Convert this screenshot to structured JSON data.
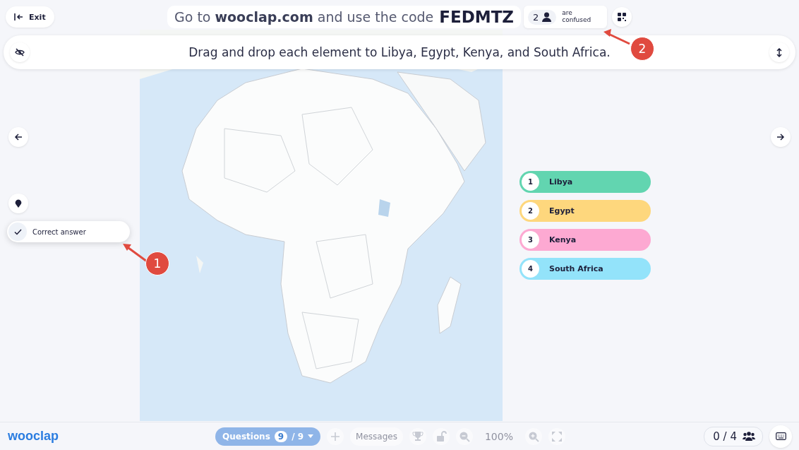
{
  "exit_button": {
    "label": "Exit"
  },
  "join_banner": {
    "text": "Go to **wooclap.com** and use the code",
    "code": "FEDMTZ"
  },
  "confused": {
    "count": "2",
    "label": "are confused"
  },
  "question": {
    "text": "Drag and drop each element to Libya, Egypt, Kenya, and South Africa.",
    "hidden_eye": true
  },
  "correct_answer": {
    "label": "Correct answer",
    "checked": true
  },
  "labels": [
    {
      "number": "1",
      "name": "Libya",
      "color": "#62d5b0"
    },
    {
      "number": "2",
      "name": "Egypt",
      "color": "#fed77d"
    },
    {
      "number": "3",
      "name": "Kenya",
      "color": "#fda9d2"
    },
    {
      "number": "4",
      "name": "South Africa",
      "color": "#93e3fa"
    }
  ],
  "annotations": [
    {
      "number": "1"
    },
    {
      "number": "2"
    }
  ],
  "footer": {
    "logo": "wooclap",
    "questions": {
      "label": "Questions",
      "current": "9",
      "total": "/ 9",
      "disabled": true
    },
    "items": [
      {
        "kind": "plus",
        "disabled": true
      },
      {
        "kind": "button",
        "label": "Messages",
        "disabled": true
      },
      {
        "kind": "trophy",
        "disabled": true
      },
      {
        "kind": "lock",
        "disabled": true
      },
      {
        "kind": "zoom_out",
        "disabled": true
      },
      {
        "kind": "zoom_level",
        "label": "100%",
        "disabled": true
      },
      {
        "kind": "zoom_in",
        "disabled": true
      },
      {
        "kind": "fullscreen",
        "disabled": true
      }
    ],
    "participants": "0 / 4"
  }
}
